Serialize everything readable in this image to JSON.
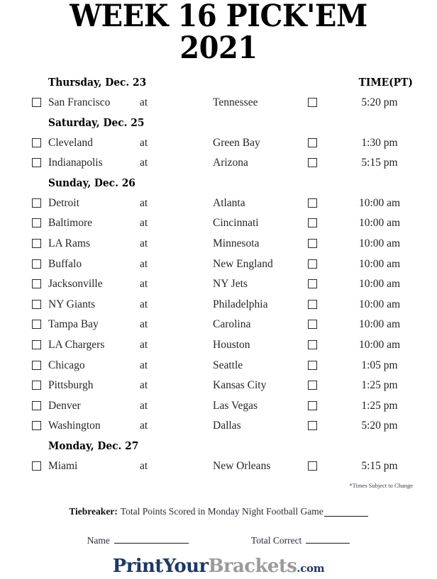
{
  "title": {
    "line1": "WEEK 16 PICK'EM",
    "line2": "2021"
  },
  "columns": {
    "time_header": "TIME(PT)",
    "at_label": "at"
  },
  "days": [
    {
      "header": "Thursday, Dec. 23",
      "games": [
        {
          "away": "San Francisco",
          "at": "at",
          "home": "Tennessee",
          "time": "5:20 pm"
        }
      ]
    },
    {
      "header": "Saturday, Dec. 25",
      "games": [
        {
          "away": "Cleveland",
          "at": "at",
          "home": "Green Bay",
          "time": "1:30 pm"
        },
        {
          "away": "Indianapolis",
          "at": "at",
          "home": "Arizona",
          "time": "5:15 pm"
        }
      ]
    },
    {
      "header": "Sunday, Dec. 26",
      "games": [
        {
          "away": "Detroit",
          "at": "at",
          "home": "Atlanta",
          "time": "10:00 am"
        },
        {
          "away": "Baltimore",
          "at": "at",
          "home": "Cincinnati",
          "time": "10:00 am"
        },
        {
          "away": "LA Rams",
          "at": "at",
          "home": "Minnesota",
          "time": "10:00 am"
        },
        {
          "away": "Buffalo",
          "at": "at",
          "home": "New England",
          "time": "10:00 am"
        },
        {
          "away": "Jacksonville",
          "at": "at",
          "home": "NY Jets",
          "time": "10:00 am"
        },
        {
          "away": "NY Giants",
          "at": "at",
          "home": "Philadelphia",
          "time": "10:00 am"
        },
        {
          "away": "Tampa Bay",
          "at": "at",
          "home": "Carolina",
          "time": "10:00 am"
        },
        {
          "away": "LA Chargers",
          "at": "at",
          "home": "Houston",
          "time": "10:00 am"
        },
        {
          "away": "Chicago",
          "at": "at",
          "home": "Seattle",
          "time": "1:05 pm"
        },
        {
          "away": "Pittsburgh",
          "at": "at",
          "home": "Kansas City",
          "time": "1:25 pm"
        },
        {
          "away": "Denver",
          "at": "at",
          "home": "Las Vegas",
          "time": "1:25 pm"
        },
        {
          "away": "Washington",
          "at": "at",
          "home": "Dallas",
          "time": "5:20 pm"
        }
      ]
    },
    {
      "header": "Monday, Dec. 27",
      "games": [
        {
          "away": "Miami",
          "at": "at",
          "home": "New Orleans",
          "time": "5:15 pm"
        }
      ]
    }
  ],
  "footer": {
    "times_note": "*Times Subject to Change",
    "tiebreaker_label": "Tiebreaker:",
    "tiebreaker_text": "Total Points Scored in Monday Night Football Game",
    "name_label": "Name",
    "total_correct_label": "Total Correct"
  },
  "logo": {
    "part1": "PrintYour",
    "part2": "Brackets",
    "part3": ".com",
    "navy": "#1f3864",
    "gray": "#9b9b9b"
  }
}
